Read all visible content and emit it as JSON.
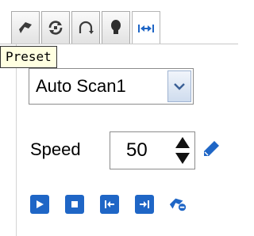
{
  "tabs": [
    {
      "icon": "preset-icon",
      "tooltip": "Preset",
      "active": false
    },
    {
      "icon": "patrol-icon",
      "active": false
    },
    {
      "icon": "pattern-icon",
      "active": false
    },
    {
      "icon": "light-icon",
      "active": false
    },
    {
      "icon": "auto-scan-icon",
      "active": true
    }
  ],
  "tooltip": {
    "text": "Preset"
  },
  "preset_select": {
    "value": "Auto Scan1"
  },
  "speed": {
    "label": "Speed",
    "value": "50"
  },
  "controls": [
    "play-icon",
    "stop-icon",
    "set-left-limit-icon",
    "set-right-limit-icon",
    "clear-limit-icon"
  ],
  "colors": {
    "accent": "#1f66c6",
    "tooltip_bg": "#ffffe1",
    "tab_border": "#a9a9a9"
  }
}
